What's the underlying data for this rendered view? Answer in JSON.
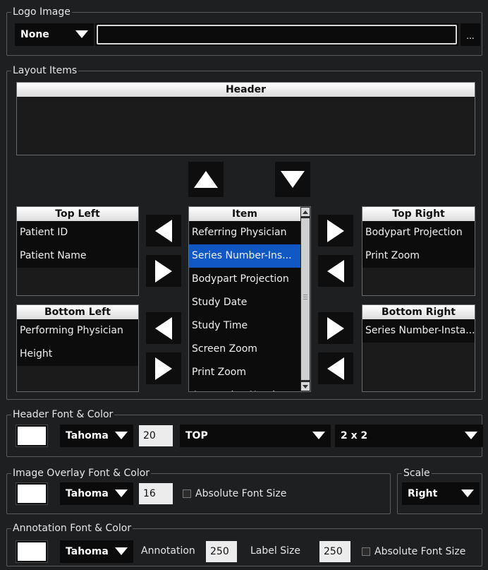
{
  "logo": {
    "legend": "Logo Image",
    "select_value": "None",
    "path_value": "",
    "browse_label": "..."
  },
  "layout": {
    "legend": "Layout Items",
    "header_title": "Header",
    "top_left": {
      "title": "Top Left",
      "items": [
        "Patient ID",
        "Patient Name"
      ]
    },
    "item": {
      "title": "Item",
      "items": [
        "Referring Physician",
        "Series Number-Ins...",
        "Bodypart Projection",
        "Study Date",
        "Study Time",
        "Screen Zoom",
        "Print Zoom",
        "Annotation Number"
      ],
      "selected_index": 1
    },
    "top_right": {
      "title": "Top Right",
      "items": [
        "Bodypart Projection",
        "Print Zoom"
      ]
    },
    "bottom_left": {
      "title": "Bottom Left",
      "items": [
        "Performing Physician",
        "Height"
      ]
    },
    "bottom_right": {
      "title": "Bottom Right",
      "items": [
        "Series Number-Insta..."
      ]
    }
  },
  "header_font": {
    "legend": "Header Font & Color",
    "font": "Tahoma",
    "size": "20",
    "position": "TOP",
    "grid": "2 x 2"
  },
  "overlay_font": {
    "legend": "Image Overlay Font & Color",
    "font": "Tahoma",
    "size": "16",
    "absolute_label": "Absolute Font Size"
  },
  "scale": {
    "legend": "Scale",
    "value": "Right"
  },
  "annotation_font": {
    "legend": "Annotation Font & Color",
    "font": "Tahoma",
    "annotation_label": "Annotation",
    "annotation_value": "250",
    "label_size_label": "Label Size",
    "label_size_value": "250",
    "absolute_label": "Absolute Font Size"
  },
  "colors": {
    "background": "#1d1f21",
    "selection": "#1157c4",
    "swatch": "#ffffff"
  }
}
